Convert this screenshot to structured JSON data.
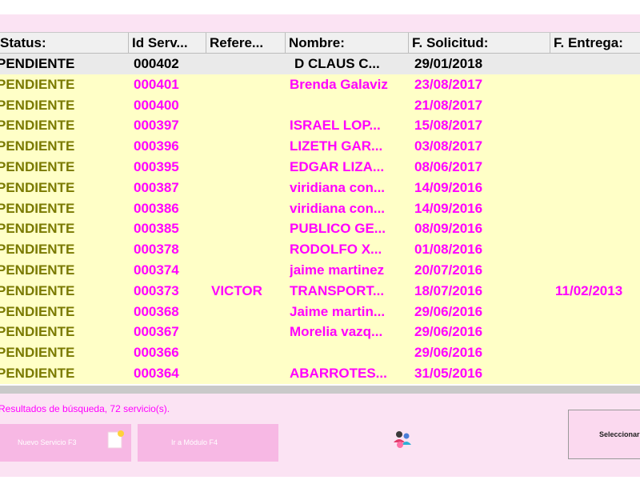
{
  "table": {
    "columns": [
      "Status:",
      "Id Serv...",
      "Refere...",
      "Nombre:",
      "F. Solicitud:",
      "F. Entrega:"
    ],
    "rows": [
      {
        "status": "PENDIENTE",
        "id": "000402",
        "ref": "",
        "name": "D CLAUS C...",
        "fsol": "29/01/2018",
        "fent": "",
        "selected": true
      },
      {
        "status": "PENDIENTE",
        "id": "000401",
        "ref": "",
        "name": "Brenda Galaviz",
        "fsol": "23/08/2017",
        "fent": ""
      },
      {
        "status": "PENDIENTE",
        "id": "000400",
        "ref": "",
        "name": "",
        "fsol": "21/08/2017",
        "fent": ""
      },
      {
        "status": "PENDIENTE",
        "id": "000397",
        "ref": "",
        "name": "ISRAEL LOP...",
        "fsol": "15/08/2017",
        "fent": ""
      },
      {
        "status": "PENDIENTE",
        "id": "000396",
        "ref": "",
        "name": "LIZETH GAR...",
        "fsol": "03/08/2017",
        "fent": ""
      },
      {
        "status": "PENDIENTE",
        "id": "000395",
        "ref": "",
        "name": "EDGAR LIZA...",
        "fsol": "08/06/2017",
        "fent": ""
      },
      {
        "status": "PENDIENTE",
        "id": "000387",
        "ref": "",
        "name": "viridiana con...",
        "fsol": "14/09/2016",
        "fent": ""
      },
      {
        "status": "PENDIENTE",
        "id": "000386",
        "ref": "",
        "name": "viridiana con...",
        "fsol": "14/09/2016",
        "fent": ""
      },
      {
        "status": "PENDIENTE",
        "id": "000385",
        "ref": "",
        "name": "PUBLICO GE...",
        "fsol": "08/09/2016",
        "fent": ""
      },
      {
        "status": "PENDIENTE",
        "id": "000378",
        "ref": "",
        "name": "RODOLFO X...",
        "fsol": "01/08/2016",
        "fent": ""
      },
      {
        "status": "PENDIENTE",
        "id": "000374",
        "ref": "",
        "name": "jaime martinez",
        "fsol": "20/07/2016",
        "fent": ""
      },
      {
        "status": "PENDIENTE",
        "id": "000373",
        "ref": "VICTOR",
        "name": "TRANSPORT...",
        "fsol": "18/07/2016",
        "fent": "11/02/2013"
      },
      {
        "status": "PENDIENTE",
        "id": "000368",
        "ref": "",
        "name": "Jaime martin...",
        "fsol": "29/06/2016",
        "fent": ""
      },
      {
        "status": "PENDIENTE",
        "id": "000367",
        "ref": "",
        "name": "Morelia vazq...",
        "fsol": "29/06/2016",
        "fent": ""
      },
      {
        "status": "PENDIENTE",
        "id": "000366",
        "ref": "",
        "name": "",
        "fsol": "29/06/2016",
        "fent": ""
      },
      {
        "status": "PENDIENTE",
        "id": "000364",
        "ref": "",
        "name": "ABARROTES...",
        "fsol": "31/05/2016",
        "fent": ""
      }
    ]
  },
  "footer": {
    "results_text": "Resultados de búsqueda, 72 servicio(s).",
    "new_service_label": "Nuevo Servicio F3",
    "goto_module_label": "Ir a Módulo  F4",
    "select_label": "Seleccionar",
    "new_service_icon": "document-icon",
    "goto_module_icon": "users-icon"
  },
  "colors": {
    "row_bg": "#ffffc7",
    "selected_row_bg": "#eaeaea",
    "status_text": "#7a7a00",
    "data_text": "#ff00ff",
    "panel_bg": "#fbe3f3",
    "button_bg": "#f7b8e4"
  }
}
